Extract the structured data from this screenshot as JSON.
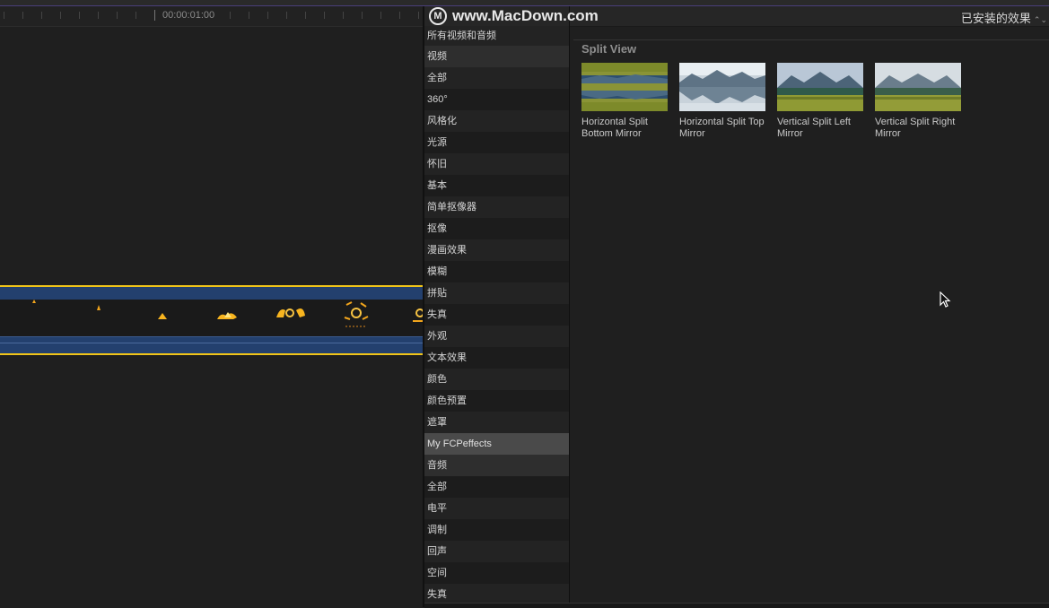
{
  "timeline": {
    "timecode": "00:00:01:00"
  },
  "watermark": {
    "text": "www.MacDown.com"
  },
  "sidebar": {
    "items": [
      {
        "label": "所有视频和音频",
        "kind": "root"
      },
      {
        "label": "视频",
        "kind": "category"
      },
      {
        "label": "全部",
        "kind": "item"
      },
      {
        "label": "360°",
        "kind": "item"
      },
      {
        "label": "风格化",
        "kind": "item"
      },
      {
        "label": "光源",
        "kind": "item"
      },
      {
        "label": "怀旧",
        "kind": "item"
      },
      {
        "label": "基本",
        "kind": "item"
      },
      {
        "label": "简单抠像器",
        "kind": "item"
      },
      {
        "label": "抠像",
        "kind": "item"
      },
      {
        "label": "漫画效果",
        "kind": "item"
      },
      {
        "label": "模糊",
        "kind": "item"
      },
      {
        "label": "拼贴",
        "kind": "item"
      },
      {
        "label": "失真",
        "kind": "item"
      },
      {
        "label": "外观",
        "kind": "item"
      },
      {
        "label": "文本效果",
        "kind": "item"
      },
      {
        "label": "颜色",
        "kind": "item"
      },
      {
        "label": "颜色预置",
        "kind": "item"
      },
      {
        "label": "遮罩",
        "kind": "item"
      },
      {
        "label": "My FCPeffects",
        "kind": "selected"
      },
      {
        "label": "音频",
        "kind": "category"
      },
      {
        "label": "全部",
        "kind": "item"
      },
      {
        "label": "电平",
        "kind": "item"
      },
      {
        "label": "调制",
        "kind": "item"
      },
      {
        "label": "回声",
        "kind": "item"
      },
      {
        "label": "空间",
        "kind": "item"
      },
      {
        "label": "失真",
        "kind": "item"
      }
    ]
  },
  "browser": {
    "filter_label": "已安装的效果",
    "filter_icon": "chevron-updown-icon",
    "section_title": "Split View",
    "effects": [
      {
        "label": "Horizontal Split Bottom Mirror",
        "mirror": "horizontal-bottom"
      },
      {
        "label": "Horizontal Split Top Mirror",
        "mirror": "horizontal-top"
      },
      {
        "label": "Vertical Split Left Mirror",
        "mirror": "vertical-left"
      },
      {
        "label": "Vertical Split Right Mirror",
        "mirror": "vertical-right"
      }
    ]
  },
  "colors": {
    "clip_border": "#f0c419",
    "clip_band": "#23406e",
    "selection": "#4a4a4a",
    "background": "#1f1f1f"
  }
}
